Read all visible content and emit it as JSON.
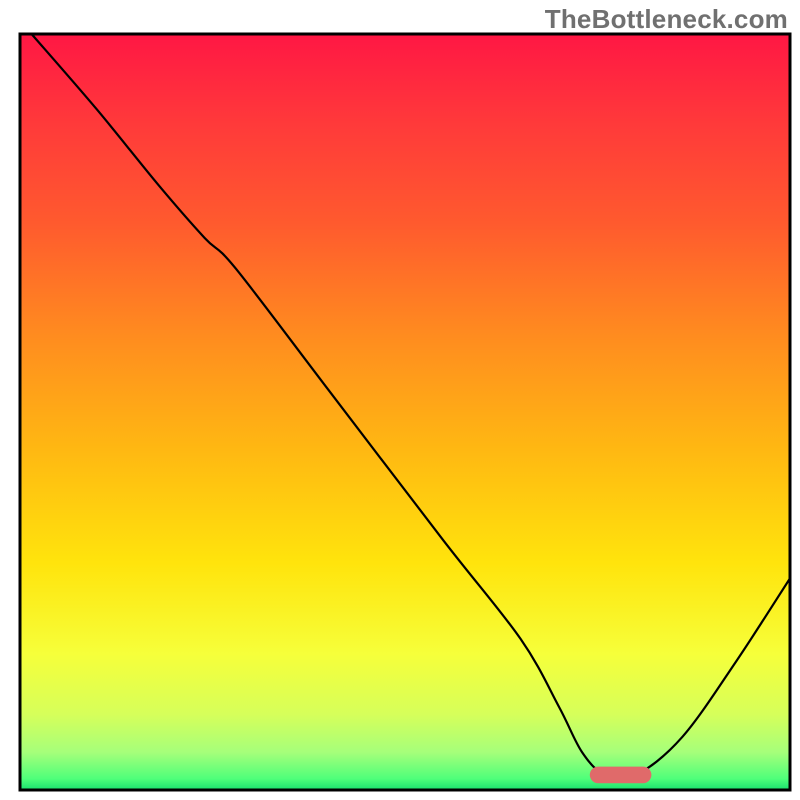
{
  "watermark": "TheBottleneck.com",
  "chart_data": {
    "type": "line",
    "title": "",
    "xlabel": "",
    "ylabel": "",
    "xlim": [
      0,
      100
    ],
    "ylim": [
      0,
      100
    ],
    "grid": false,
    "legend": false,
    "background_gradient_stops": [
      {
        "offset": 0.0,
        "color": "#ff1744"
      },
      {
        "offset": 0.12,
        "color": "#ff3a3a"
      },
      {
        "offset": 0.25,
        "color": "#ff5a2e"
      },
      {
        "offset": 0.4,
        "color": "#ff8c1f"
      },
      {
        "offset": 0.55,
        "color": "#ffb812"
      },
      {
        "offset": 0.7,
        "color": "#ffe40c"
      },
      {
        "offset": 0.82,
        "color": "#f6ff3a"
      },
      {
        "offset": 0.9,
        "color": "#d6ff5a"
      },
      {
        "offset": 0.95,
        "color": "#a6ff7a"
      },
      {
        "offset": 0.985,
        "color": "#4fff7a"
      },
      {
        "offset": 1.0,
        "color": "#18e06e"
      }
    ],
    "series": [
      {
        "name": "bottleneck-curve",
        "color": "#000000",
        "stroke_width": 2.2,
        "x": [
          1.5,
          10,
          18,
          24,
          28,
          40,
          55,
          65,
          70,
          73,
          76,
          80,
          86,
          93,
          100
        ],
        "y": [
          100,
          90,
          80,
          73,
          69,
          53,
          33,
          20,
          11,
          5,
          2,
          2,
          7,
          17,
          28
        ]
      }
    ],
    "marker": {
      "name": "optimal-range",
      "shape": "rounded-rect",
      "color": "#e06a6a",
      "x_center": 78,
      "y_center": 2,
      "width": 8,
      "height": 2.2,
      "corner_radius": 1.1
    },
    "axes": {
      "show_ticks": false,
      "frame_color": "#000000",
      "frame_width": 3
    }
  }
}
